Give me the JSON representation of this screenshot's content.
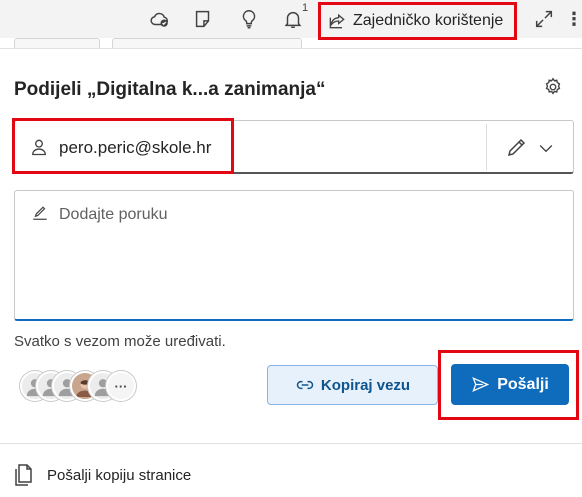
{
  "toolbar": {
    "icons": [
      "cloud-check-icon",
      "notes-icon",
      "lightbulb-icon",
      "bell-icon",
      "share-icon",
      "expand-icon",
      "more-icon"
    ],
    "notification_count": "1",
    "share_label": "Zajedničko korištenje",
    "more_label": "⋮"
  },
  "dialog": {
    "title": "Podijeli „Digitalna k...a zanimanja“",
    "to_value": "pero.peric@skole.hr",
    "message_placeholder": "Dodajte poruku",
    "permission_text": "Svatko s vezom može uređivati.",
    "avatars_more_label": "···",
    "copy_link_label": "Kopiraj vezu",
    "send_label": "Pošalji",
    "send_copy_label": "Pošalji kopiju stranice"
  },
  "colors": {
    "accent": "#0f6cbd",
    "highlight": "#e30613",
    "copy_button_bg": "#e7f1fb"
  }
}
